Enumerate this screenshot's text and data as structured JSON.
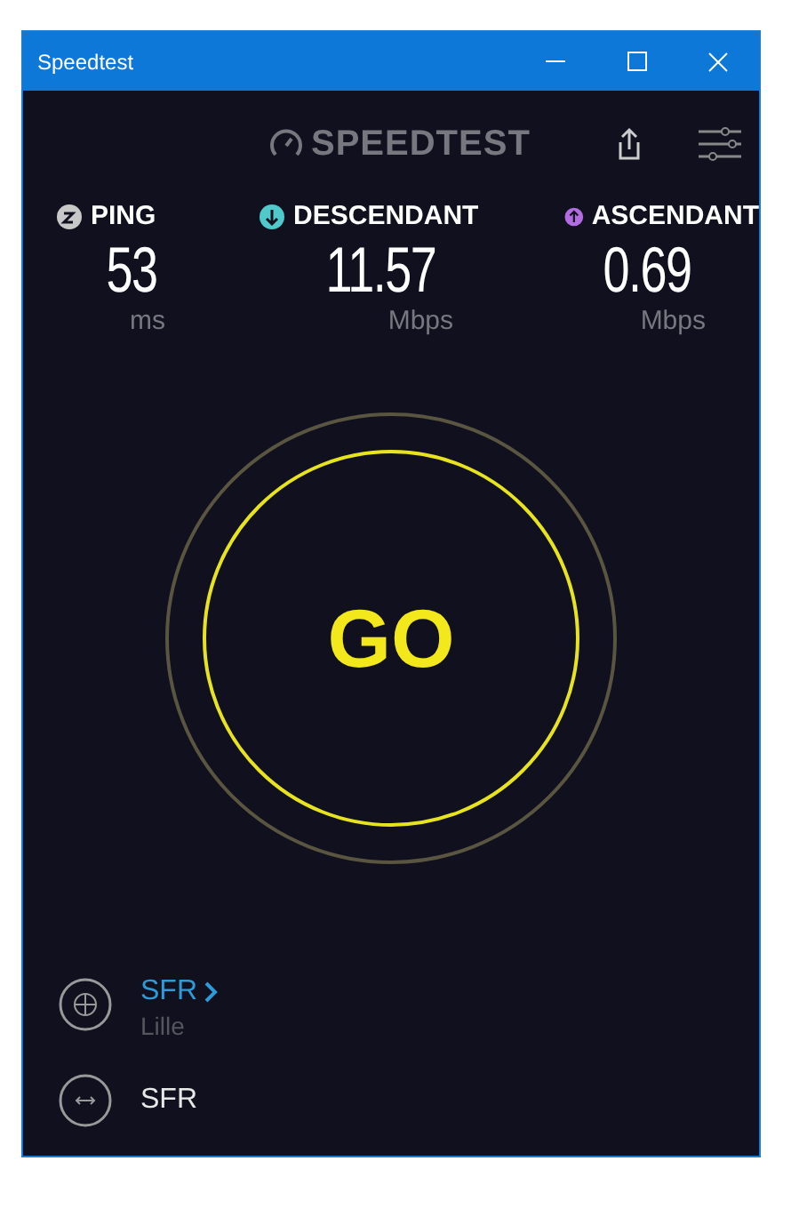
{
  "window": {
    "title": "Speedtest"
  },
  "header": {
    "logo": "SPEEDTEST"
  },
  "metrics": [
    {
      "kind": "ping",
      "label": "PING",
      "value": "53",
      "unit": "ms",
      "color": "#c8c8c8"
    },
    {
      "kind": "download",
      "label": "DESCENDANT",
      "value": "11.57",
      "unit": "Mbps",
      "color": "#4fc9c9"
    },
    {
      "kind": "upload",
      "label": "ASCENDANT",
      "value": "0.69",
      "unit": "Mbps",
      "color": "#b06ce0"
    }
  ],
  "go_button": "GO",
  "provider": {
    "name": "SFR",
    "location": "Lille"
  },
  "server": {
    "name": "SFR"
  }
}
